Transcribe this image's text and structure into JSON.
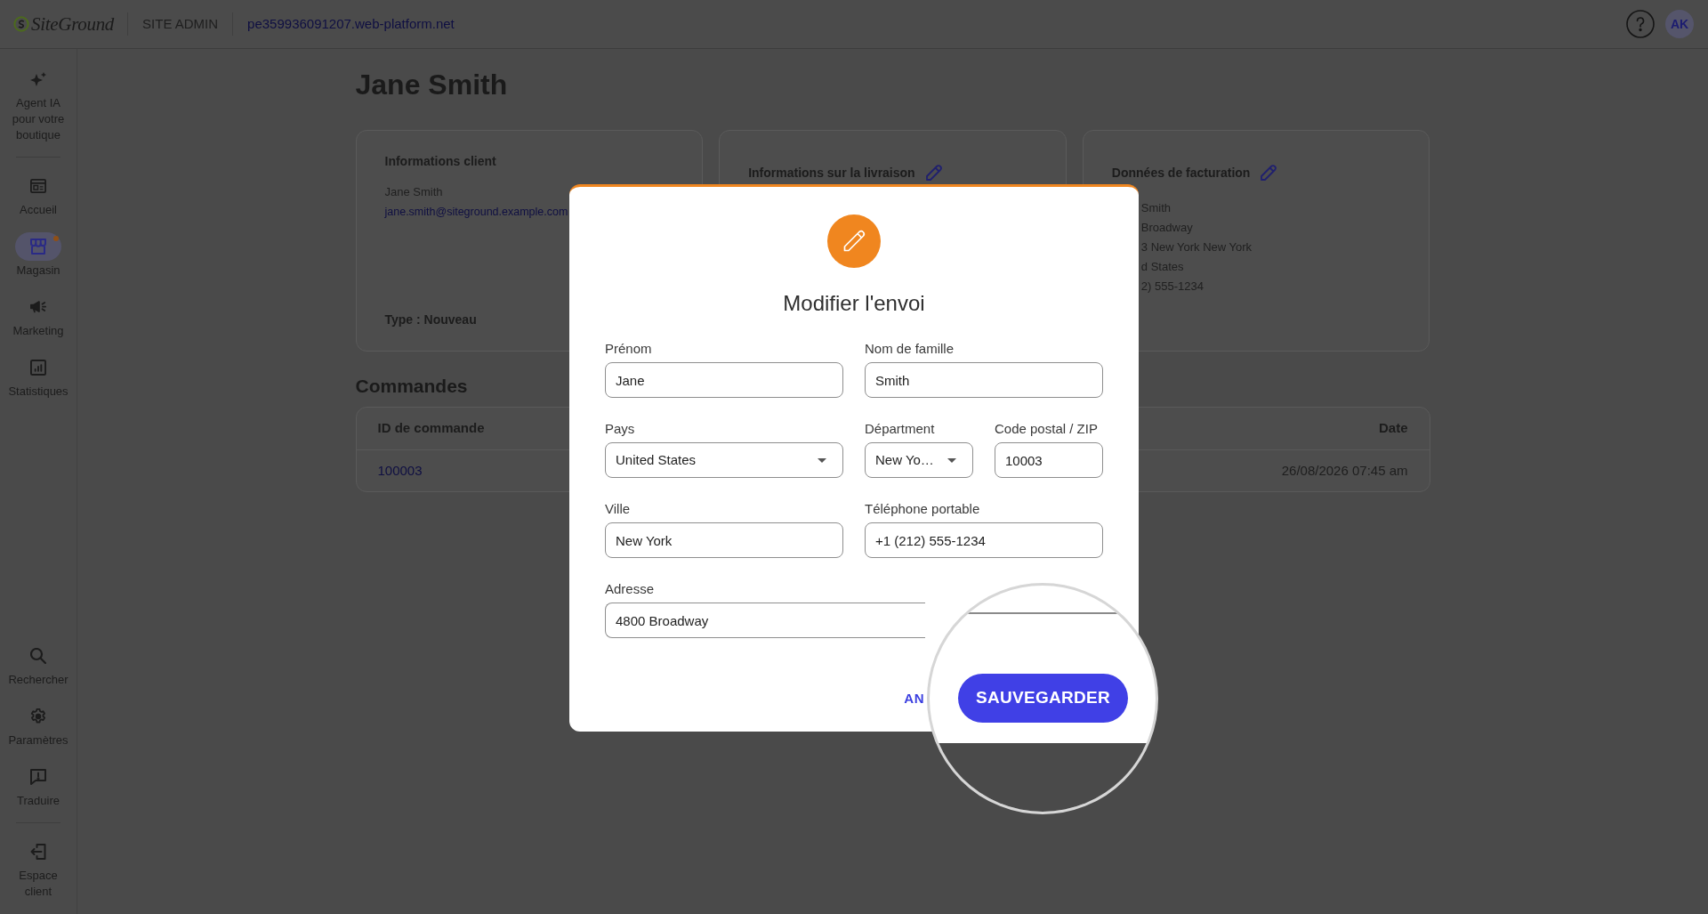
{
  "header": {
    "logo": "SiteGround",
    "section": "SITE ADMIN",
    "site_url": "pe359936091207.web-platform.net",
    "avatar": "AK"
  },
  "sidebar": {
    "top": [
      {
        "items": [
          {
            "label": "Agent IA pour votre boutique",
            "selected": false,
            "notification": false
          }
        ]
      },
      {
        "items": [
          {
            "label": "Accueil",
            "selected": false,
            "notification": false
          },
          {
            "label": "Magasin",
            "selected": true,
            "notification": true
          },
          {
            "label": "Marketing",
            "selected": false,
            "notification": false
          },
          {
            "label": "Statistiques",
            "selected": false,
            "notification": false
          }
        ]
      }
    ],
    "bottom": [
      {
        "items": [
          {
            "label": "Rechercher",
            "selected": false,
            "notification": false
          },
          {
            "label": "Paramètres",
            "selected": false,
            "notification": false
          },
          {
            "label": "Traduire",
            "selected": false,
            "notification": false
          }
        ]
      },
      {
        "items": [
          {
            "label": "Espace client",
            "selected": false,
            "notification": false
          }
        ]
      }
    ]
  },
  "page": {
    "title": "Jane Smith",
    "cards": [
      {
        "title": "Informations client",
        "editable": false,
        "cut_left": false,
        "lines": [
          {
            "text": "Jane Smith",
            "kind": "text"
          },
          {
            "text": "jane.smith@siteground.example.com",
            "kind": "link"
          }
        ],
        "footer": "Type : Nouveau"
      },
      {
        "title": "Informations sur la livraison",
        "editable": true
      },
      {
        "title": "Données de facturation",
        "editable": true,
        "cut_left": true,
        "lines": [
          {
            "text": "Smith",
            "kind": "text"
          },
          {
            "text": "Broadway",
            "kind": "text"
          },
          {
            "text": "3 New York New York",
            "kind": "text"
          },
          {
            "text": "d States",
            "kind": "text"
          },
          {
            "text": "2) 555-1234",
            "kind": "text"
          }
        ]
      }
    ],
    "orders": {
      "title": "Commandes",
      "columns": [
        "ID de commande",
        "Date"
      ],
      "rows": [
        {
          "cells": [
            {
              "text": "100003",
              "kind": "link"
            },
            {
              "text": "26/08/2026 07:45 am",
              "kind": "text"
            }
          ]
        }
      ]
    }
  },
  "dialog": {
    "title": "Modifier l'envoi",
    "rows": [
      {
        "fields": [
          {
            "label": "Prénom",
            "value": "Jane",
            "kind": "text"
          },
          {
            "label": "Nom de famille",
            "value": "Smith",
            "kind": "text"
          }
        ]
      },
      {
        "fields": [
          {
            "label": "Pays",
            "value": "United States",
            "kind": "select"
          },
          {
            "label": "Départment",
            "value": "New Yo…",
            "kind": "select"
          },
          {
            "label": "Code postal / ZIP",
            "value": "10003",
            "kind": "text"
          }
        ]
      },
      {
        "fields": [
          {
            "label": "Ville",
            "value": "New York",
            "kind": "text"
          },
          {
            "label": "Téléphone portable",
            "value": "+1 (212) 555-1234",
            "kind": "text"
          }
        ]
      },
      {
        "fields": [
          {
            "label": "Adresse",
            "value": "4800 Broadway",
            "kind": "text"
          }
        ]
      }
    ],
    "buttons": [
      {
        "label": "AN",
        "kind": "text"
      }
    ]
  },
  "magnifier": {
    "button": {
      "label": "SAUVEGARDER",
      "kind": "primary"
    }
  }
}
